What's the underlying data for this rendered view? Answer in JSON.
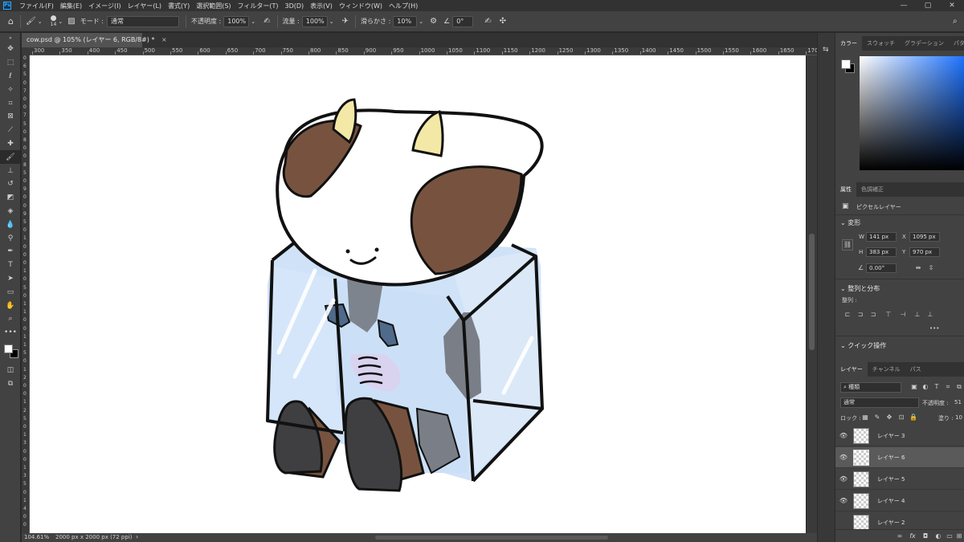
{
  "app": {
    "logo": "Ps"
  },
  "menubar": {
    "items": [
      "ファイル(F)",
      "編集(E)",
      "イメージ(I)",
      "レイヤー(L)",
      "書式(Y)",
      "選択範囲(S)",
      "フィルター(T)",
      "3D(D)",
      "表示(V)",
      "ウィンドウ(W)",
      "ヘルプ(H)"
    ],
    "window_controls": [
      "—",
      "▢",
      "✕"
    ]
  },
  "options": {
    "brush_size": "14",
    "mode_label": "モード :",
    "mode_value": "通常",
    "opacity_label": "不透明度 :",
    "opacity_value": "100%",
    "flow_label": "流量 :",
    "flow_value": "100%",
    "smoothing_label": "滑らかさ :",
    "smoothing_value": "10%",
    "angle_value": "0°"
  },
  "document": {
    "tab_title": "cow.psd @ 105% (レイヤー 6, RGB/8#) *",
    "close": "×"
  },
  "ruler": {
    "top_labels": [
      "300",
      "350",
      "400",
      "450",
      "500",
      "550",
      "600",
      "650",
      "700",
      "750",
      "800",
      "850",
      "900",
      "950",
      "1000",
      "1050",
      "1100",
      "1150",
      "1200",
      "1250",
      "1300",
      "1350",
      "1400",
      "1450",
      "1500",
      "1550",
      "1600",
      "1650",
      "170"
    ],
    "left_labels": [
      "0",
      "6",
      "5",
      "0",
      "7",
      "0",
      "0",
      "7",
      "5",
      "0",
      "8",
      "0",
      "0",
      "8",
      "5",
      "0",
      "9",
      "0",
      "0",
      "9",
      "5",
      "0",
      "1",
      "0",
      "0",
      "0",
      "1",
      "0",
      "5",
      "0",
      "1",
      "1",
      "0",
      "0",
      "1",
      "1",
      "5",
      "0",
      "1",
      "2",
      "0",
      "0",
      "1",
      "2",
      "5",
      "0",
      "1",
      "3",
      "0",
      "0",
      "1",
      "3",
      "5",
      "0",
      "1",
      "4",
      "0",
      "0"
    ]
  },
  "status": {
    "zoom": "104.61%",
    "doc_size": "2000 px x 2000 px (72 ppi)",
    "arrow": "›"
  },
  "color_panel": {
    "tabs": [
      "カラー",
      "スウォッチ",
      "グラデーション",
      "パターン"
    ],
    "foreground": "#ffffff",
    "background": "#000000"
  },
  "properties": {
    "tabs": [
      "属性",
      "色調補正"
    ],
    "layer_type": "ピクセルレイヤー",
    "transform_title": "変形",
    "w_label": "W",
    "w_value": "141 px",
    "h_label": "H",
    "h_value": "383 px",
    "x_label": "X",
    "x_value": "1095 px",
    "y_label": "Y",
    "y_value": "970 px",
    "angle_value": "0.00°",
    "align_title": "整列と分布",
    "align_sub": "整列 :",
    "quick_title": "クイック操作",
    "more": "•••"
  },
  "layers_panel": {
    "tabs": [
      "レイヤー",
      "チャンネル",
      "パス"
    ],
    "filter_kind": "種類",
    "blend_mode": "通常",
    "opacity_label": "不透明度 :",
    "opacity_value": "51",
    "lock_label": "ロック :",
    "fill_label": "塗り :",
    "fill_value": "10",
    "layers": [
      {
        "name": "レイヤー 3",
        "visible": "👁"
      },
      {
        "name": "レイヤー 6",
        "visible": "👁"
      },
      {
        "name": "レイヤー 5",
        "visible": "👁"
      },
      {
        "name": "レイヤー 4",
        "visible": "👁"
      },
      {
        "name": "レイヤー 2",
        "visible": ""
      }
    ]
  }
}
